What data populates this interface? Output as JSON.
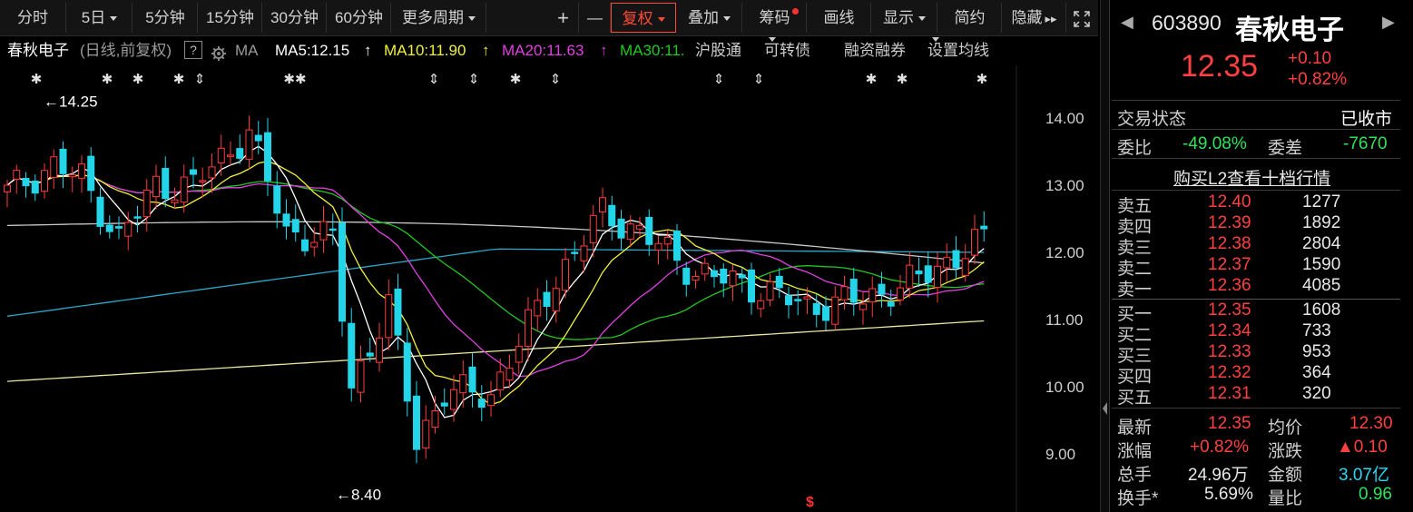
{
  "toolbar": {
    "periods": [
      "分时",
      "5日",
      "5分钟",
      "15分钟",
      "30分钟",
      "60分钟",
      "更多周期"
    ],
    "plus": "+",
    "minus": "—",
    "fuquan": "复权",
    "diejia": "叠加",
    "chouma": "筹码",
    "huaxian": "画线",
    "xianshi": "显示",
    "jianyue": "简约",
    "yincang": "隐藏",
    "expand_icon": "expand-icon"
  },
  "legend": {
    "name": "春秋电子",
    "mode": "(日线,前复权)",
    "help": "?",
    "ma": "MA",
    "ma5": "MA5:12.15",
    "ma10": "MA10:11.90",
    "ma20": "MA20:11.63",
    "ma30": "MA30:11.",
    "hugutong": "沪股通",
    "kezhuanzhai": "可转债",
    "rongzi": "融资融券",
    "shezhi": "设置均线"
  },
  "colors": {
    "up": "#ff3b3b",
    "down": "#22d5e8",
    "ma5": "#ffffff",
    "ma10": "#f0f03a",
    "ma20": "#e040e0",
    "ma30": "#20c820",
    "ma60": "#c8c8c8",
    "ma120": "#2aa8c8",
    "ma250": "#e8e8a0"
  },
  "chart_data": {
    "type": "candlestick",
    "yticks": [
      "14.00",
      "13.00",
      "12.00",
      "11.00",
      "10.00",
      "9.00"
    ],
    "ylim": [
      8.3,
      14.6
    ],
    "high_label": "14.25",
    "low_label": "8.40",
    "bottom_marker": "$",
    "top_markers": [
      "✱",
      "✱",
      "✱",
      "✱",
      "⇕",
      "✱✱",
      "⇕",
      "⇕",
      "✱",
      "⇕",
      "⇕",
      "⇕",
      "✱",
      "✱",
      "✱"
    ]
  },
  "panel": {
    "code": "603890",
    "name": "春秋电子",
    "price": "12.35",
    "change": "+0.10",
    "pct": "+0.82%",
    "status_label": "交易状态",
    "status": "已收市",
    "weibi_label": "委比",
    "weibi": "-49.08%",
    "weicha_label": "委差",
    "weicha": "-7670",
    "l2_link": "购买L2查看十档行情",
    "asks": [
      {
        "label": "卖五",
        "price": "12.40",
        "vol": "1277"
      },
      {
        "label": "卖四",
        "price": "12.39",
        "vol": "1892"
      },
      {
        "label": "卖三",
        "price": "12.38",
        "vol": "2804"
      },
      {
        "label": "卖二",
        "price": "12.37",
        "vol": "1590"
      },
      {
        "label": "卖一",
        "price": "12.36",
        "vol": "4085"
      }
    ],
    "bids": [
      {
        "label": "买一",
        "price": "12.35",
        "vol": "1608"
      },
      {
        "label": "买二",
        "price": "12.34",
        "vol": "733"
      },
      {
        "label": "买三",
        "price": "12.33",
        "vol": "953"
      },
      {
        "label": "买四",
        "price": "12.32",
        "vol": "364"
      },
      {
        "label": "买五",
        "price": "12.31",
        "vol": "320"
      }
    ],
    "stats": {
      "latest_label": "最新",
      "latest": "12.35",
      "avg_label": "均价",
      "avg": "12.30",
      "zhangfu_label": "涨幅",
      "zhangfu": "+0.82%",
      "zhangdie_label": "涨跌",
      "zhangdie": "▲0.10",
      "zongshou_label": "总手",
      "zongshou": "24.96万",
      "jine_label": "金额",
      "jine": "3.07亿",
      "huanshou_label": "换手*",
      "huanshou": "5.69%",
      "liangbi_label": "量比",
      "liangbi": "0.96"
    }
  }
}
